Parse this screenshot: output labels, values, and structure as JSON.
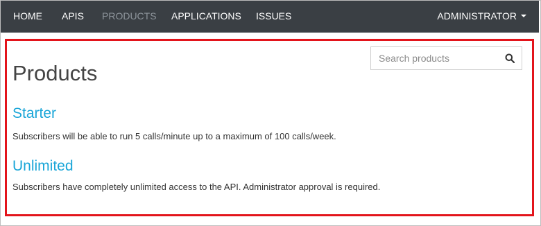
{
  "navbar": {
    "items": [
      {
        "label": "HOME",
        "active": false
      },
      {
        "label": "APIS",
        "active": false
      },
      {
        "label": "PRODUCTS",
        "active": true
      },
      {
        "label": "APPLICATIONS",
        "active": false
      },
      {
        "label": "ISSUES",
        "active": false
      }
    ],
    "user_menu_label": "ADMINISTRATOR",
    "background_color": "#3a3f44",
    "active_color": "#8d949b"
  },
  "search": {
    "placeholder": "Search products",
    "icon": "search-icon"
  },
  "page": {
    "title": "Products"
  },
  "products": [
    {
      "name": "Starter",
      "description": "Subscribers will be able to run 5 calls/minute up to a maximum of 100 calls/week."
    },
    {
      "name": "Unlimited",
      "description": "Subscribers have completely unlimited access to the API. Administrator approval is required."
    }
  ],
  "colors": {
    "link": "#1aa6d8",
    "highlight_border": "#e3141b"
  }
}
